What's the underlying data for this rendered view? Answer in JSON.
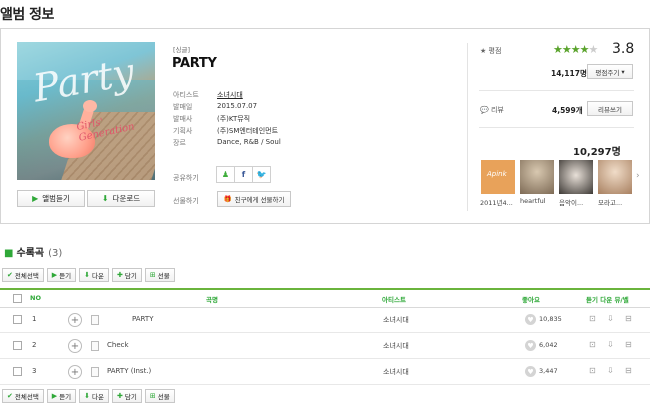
{
  "page_title": "앨범 정보",
  "album": {
    "cover_word": "Party",
    "cover_sub": "Girls' Generation",
    "type_tag": "[싱글]",
    "title": "PARTY",
    "meta": [
      {
        "key": "아티스트",
        "value": "소녀시대"
      },
      {
        "key": "발매일",
        "value": "2015.07.07"
      },
      {
        "key": "발매사",
        "value": "(주)KT뮤직"
      },
      {
        "key": "기획사",
        "value": "(주)SM엔터테인먼트"
      },
      {
        "key": "장르",
        "value": "Dance, R&B / Soul"
      }
    ],
    "listen_label": "앨범듣기",
    "download_label": "다운로드",
    "share_label": "공유하기",
    "gift_label": "선물하기",
    "gift_button": "친구에게 선물하기"
  },
  "rating": {
    "label": "평점",
    "value": "3.8",
    "stars_filled": 4,
    "stars_total": 5,
    "count": "14,117명",
    "rate_button": "평점주기"
  },
  "review": {
    "label": "리뷰",
    "count": "4,599개",
    "write_button": "리뷰쓰기"
  },
  "likes": {
    "count": "10,297명",
    "users": [
      {
        "name": "2011년4...",
        "color": "#e8a25a"
      },
      {
        "name": "heartful",
        "color": "#9c8a72"
      },
      {
        "name": "음악이...",
        "color": "#6d6660"
      },
      {
        "name": "모라고...",
        "color": "#c8a888"
      }
    ]
  },
  "tracklist": {
    "heading": "수록곡",
    "count": "(3)",
    "toolbar": [
      "전체선택",
      "듣기",
      "다운",
      "담기",
      "선물"
    ],
    "columns": {
      "no": "NO",
      "song": "곡명",
      "artist": "아티스트",
      "likes": "좋아요",
      "actions": "듣기 다운 뮤/벨"
    },
    "rows": [
      {
        "no": "1",
        "title": "PARTY",
        "artist": "소녀시대",
        "likes": "10,835"
      },
      {
        "no": "2",
        "title": "Check",
        "artist": "소녀시대",
        "likes": "6,042"
      },
      {
        "no": "3",
        "title": "PARTY (Inst.)",
        "artist": "소녀시대",
        "likes": "3,447"
      }
    ]
  },
  "colors": {
    "accent": "#2fa838",
    "header_line": "#6ab43c"
  }
}
